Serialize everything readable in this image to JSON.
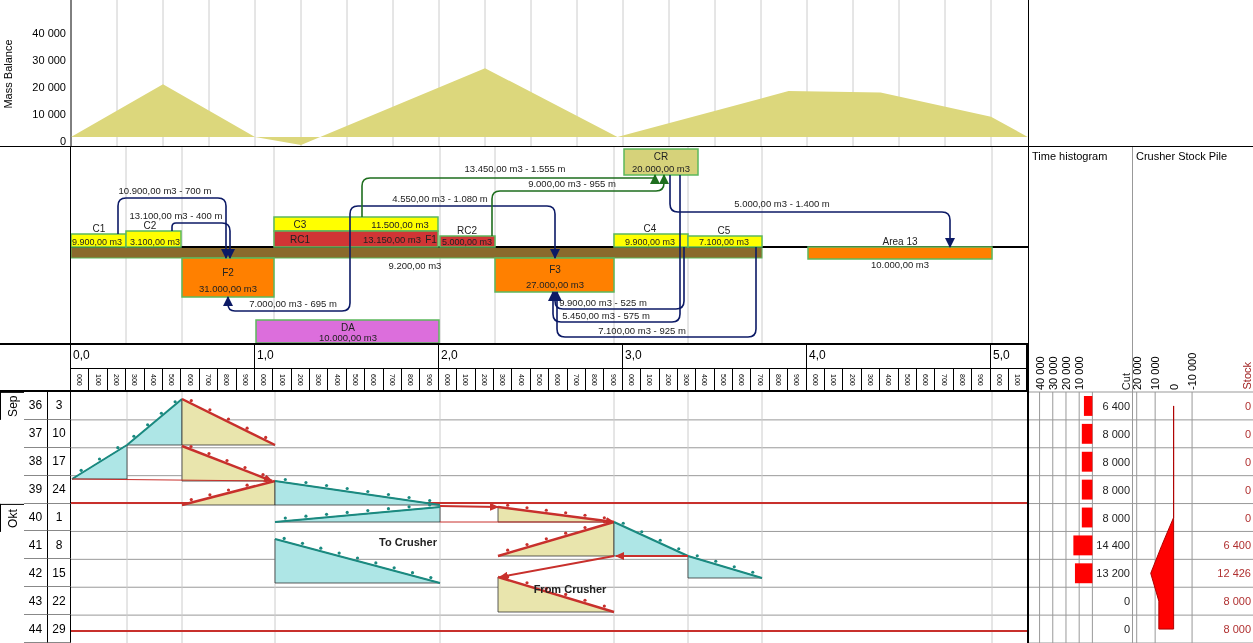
{
  "mass_balance": {
    "ylabel": "Mass Balance",
    "yticks": [
      "40 000",
      "30 000",
      "20 000",
      "10 000",
      "0"
    ]
  },
  "profile": {
    "sections": [
      {
        "name": "C1",
        "volume": "9.900,00 m3",
        "kind": "block",
        "color": "#ffff00"
      },
      {
        "name": "C2",
        "volume": "3.100,00 m3",
        "kind": "block",
        "color": "#ffff00"
      },
      {
        "name": "F2",
        "volume": "31.000,00 m3",
        "kind": "block",
        "color": "#ff8000"
      },
      {
        "name": "C3",
        "volume": "11.500,00 m3",
        "kind": "block",
        "color": "#ffff00"
      },
      {
        "name": "RC1",
        "volume": "13.150,00 m3",
        "kind": "block",
        "color": "#d03535"
      },
      {
        "name": "F1",
        "volume": "9.200,00 m3",
        "kind": "label"
      },
      {
        "name": "RC2",
        "volume": "5.000,00 m3",
        "kind": "block",
        "color": "#d03535"
      },
      {
        "name": "F3",
        "volume": "27.000,00 m3",
        "kind": "block",
        "color": "#ff8000"
      },
      {
        "name": "C4",
        "volume": "9.900,00 m3",
        "kind": "block",
        "color": "#ffff00"
      },
      {
        "name": "C5",
        "volume": "7.100,00 m3",
        "kind": "block",
        "color": "#ffff00"
      },
      {
        "name": "Area 13",
        "volume": "10.000,00 m3",
        "kind": "block",
        "color": "#ff8000"
      },
      {
        "name": "CR",
        "volume": "20.000,00 m3",
        "kind": "block",
        "color": "#d6d27a"
      },
      {
        "name": "DA",
        "volume": "10.000,00 m3",
        "kind": "block",
        "color": "#dc6edc"
      }
    ],
    "hauls": [
      {
        "label": "10.900,00 m3 - 700 m",
        "color": "#0c1a66"
      },
      {
        "label": "13.100,00 m3 - 400 m",
        "color": "#0c1a66"
      },
      {
        "label": "7.000,00 m3 - 695 m",
        "color": "#0c1a66"
      },
      {
        "label": "4.550,00 m3 - 1.080 m",
        "color": "#0c1a66"
      },
      {
        "label": "13.450,00 m3 - 1.555 m",
        "color": "#1e6e1e"
      },
      {
        "label": "9.000,00 m3 - 955 m",
        "color": "#1e6e1e"
      },
      {
        "label": "5.000,00 m3 - 1.400 m",
        "color": "#0c1a66"
      },
      {
        "label": "9.900,00 m3 - 525 m",
        "color": "#0c1a66"
      },
      {
        "label": "5.450,00 m3 - 575 m",
        "color": "#0c1a66"
      },
      {
        "label": "7.100,00 m3 - 925 m",
        "color": "#0c1a66"
      }
    ]
  },
  "axis": {
    "km": [
      {
        "label": "0,0",
        "ticks": [
          "000",
          "100",
          "200",
          "300",
          "400",
          "500",
          "600",
          "700",
          "800",
          "900"
        ]
      },
      {
        "label": "1,0",
        "ticks": [
          "000",
          "100",
          "200",
          "300",
          "400",
          "500",
          "600",
          "700",
          "800",
          "900"
        ]
      },
      {
        "label": "2,0",
        "ticks": [
          "000",
          "100",
          "200",
          "300",
          "400",
          "500",
          "600",
          "700",
          "800",
          "900"
        ]
      },
      {
        "label": "3,0",
        "ticks": [
          "000",
          "100",
          "200",
          "300",
          "400",
          "500",
          "600",
          "700",
          "800",
          "900"
        ]
      },
      {
        "label": "4,0",
        "ticks": [
          "000",
          "100",
          "200",
          "300",
          "400",
          "500",
          "600",
          "700",
          "800",
          "900"
        ]
      },
      {
        "label": "5,0",
        "ticks": [
          "000",
          "100"
        ]
      }
    ]
  },
  "calendar": {
    "months": [
      {
        "label": "Sep",
        "weeks": [
          {
            "week": "36",
            "day": "3"
          },
          {
            "week": "37",
            "day": "10"
          },
          {
            "week": "38",
            "day": "17"
          },
          {
            "week": "39",
            "day": "24"
          }
        ]
      },
      {
        "label": "Okt",
        "weeks": [
          {
            "week": "40",
            "day": "1"
          },
          {
            "week": "41",
            "day": "8"
          },
          {
            "week": "42",
            "day": "15"
          },
          {
            "week": "43",
            "day": "22"
          },
          {
            "week": "44",
            "day": "29"
          }
        ]
      }
    ]
  },
  "time_chart": {
    "labels": [
      "To Crusher",
      "From Crusher"
    ]
  },
  "time_histogram": {
    "title": "Time histogram",
    "value_header": "Cut",
    "chart_data": {
      "type": "bar",
      "orientation": "horizontal",
      "values": [
        6400,
        8000,
        8000,
        8000,
        8000,
        14400,
        13200,
        0,
        0
      ],
      "value_labels": [
        "6 400",
        "8 000",
        "8 000",
        "8 000",
        "8 000",
        "14 400",
        "13 200",
        "0",
        "0"
      ],
      "xlim": [
        48000,
        -30000
      ],
      "grid": true,
      "xticks": [
        {
          "value": 40000,
          "label": "40 000"
        },
        {
          "value": 30000,
          "label": "30 000"
        },
        {
          "value": 20000,
          "label": "20 000"
        },
        {
          "value": 10000,
          "label": "10 000"
        }
      ]
    }
  },
  "stock_pile": {
    "title": "Crusher Stock Pile",
    "value_header": "Stock",
    "value_column": [
      "0",
      "0",
      "0",
      "0",
      "0",
      "6 400",
      "12 426",
      "8 000",
      "8 000"
    ],
    "chart_data": {
      "type": "area",
      "orientation": "horizontal",
      "values": [
        0,
        0,
        0,
        0,
        0,
        6400,
        12400,
        8000,
        8000
      ],
      "xlim": [
        22000,
        -43000
      ],
      "grid": true,
      "xticks": [
        {
          "value": 20000,
          "label": "20 000"
        },
        {
          "value": 10000,
          "label": "10 000"
        },
        {
          "value": 0,
          "label": "0"
        },
        {
          "value": -10000,
          "label": "-10 000"
        }
      ]
    }
  }
}
